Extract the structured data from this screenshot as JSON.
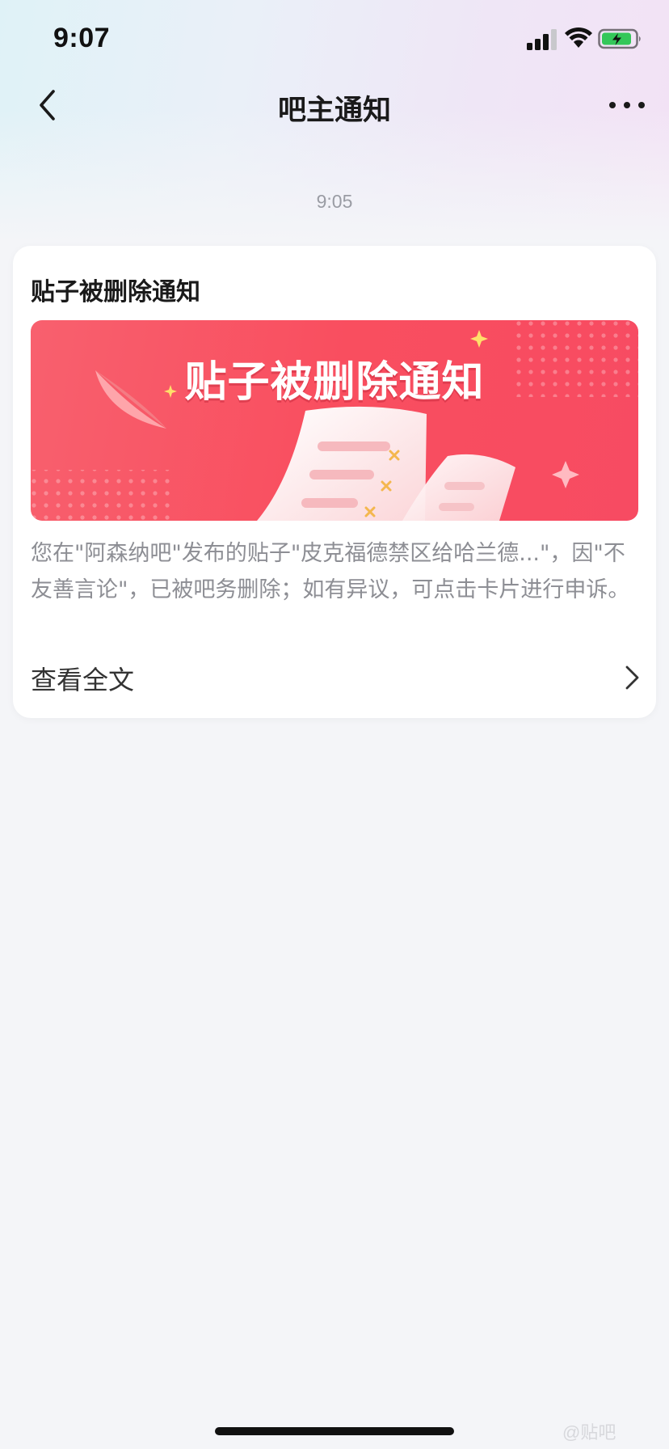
{
  "status_bar": {
    "time": "9:07",
    "signal_icon": "cellular-signal-icon",
    "wifi_icon": "wifi-icon",
    "battery_icon": "battery-charging-icon",
    "battery_color": "#34c759"
  },
  "nav": {
    "back_icon": "chevron-left-icon",
    "title": "吧主通知",
    "more_icon": "more-dots-icon"
  },
  "message": {
    "time": "9:05",
    "card": {
      "title": "贴子被删除通知",
      "banner_text": "贴子被删除通知",
      "banner_color": "#f8566a",
      "description": "您在\"阿森纳吧\"发布的贴子\"皮克福德禁区给哈兰德...\"，因\"不友善言论\"，已被吧务删除；如有异议，可点击卡片进行申诉。",
      "view_full_label": "查看全文",
      "view_full_icon": "chevron-right-icon"
    }
  },
  "watermark": "@贴吧"
}
